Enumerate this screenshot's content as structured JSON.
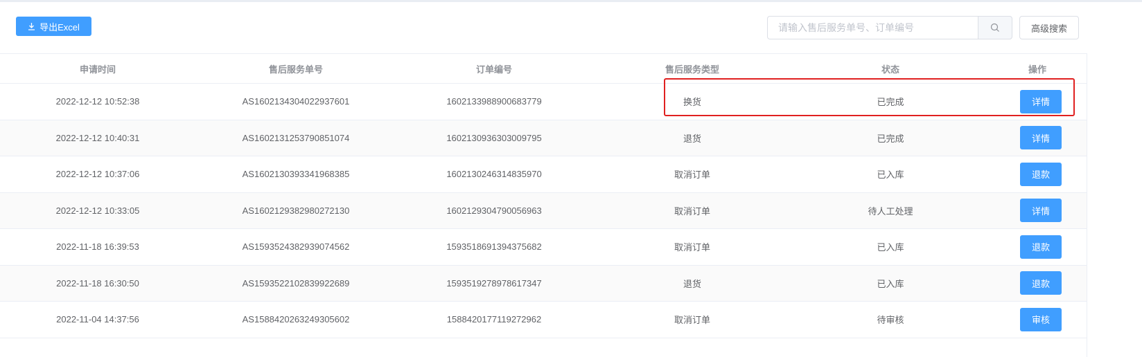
{
  "toolbar": {
    "export_label": "导出Excel",
    "search_placeholder": "请输入售后服务单号、订单编号",
    "search_value": "",
    "advanced_search_label": "高级搜索"
  },
  "table": {
    "headers": [
      "申请时间",
      "售后服务单号",
      "订单编号",
      "售后服务类型",
      "状态",
      "操作"
    ],
    "rows": [
      {
        "time": "2022-12-12 10:52:38",
        "service_no": "AS1602134304022937601",
        "order_no": "1602133988900683779",
        "type": "换货",
        "status": "已完成",
        "action": "详情"
      },
      {
        "time": "2022-12-12 10:40:31",
        "service_no": "AS1602131253790851074",
        "order_no": "1602130936303009795",
        "type": "退货",
        "status": "已完成",
        "action": "详情"
      },
      {
        "time": "2022-12-12 10:37:06",
        "service_no": "AS1602130393341968385",
        "order_no": "1602130246314835970",
        "type": "取消订单",
        "status": "已入库",
        "action": "退款"
      },
      {
        "time": "2022-12-12 10:33:05",
        "service_no": "AS1602129382980272130",
        "order_no": "1602129304790056963",
        "type": "取消订单",
        "status": "待人工处理",
        "action": "详情"
      },
      {
        "time": "2022-11-18 16:39:53",
        "service_no": "AS1593524382939074562",
        "order_no": "1593518691394375682",
        "type": "取消订单",
        "status": "已入库",
        "action": "退款"
      },
      {
        "time": "2022-11-18 16:30:50",
        "service_no": "AS1593522102839922689",
        "order_no": "1593519278978617347",
        "type": "退货",
        "status": "已入库",
        "action": "退款"
      },
      {
        "time": "2022-11-04 14:37:56",
        "service_no": "AS1588420263249305602",
        "order_no": "1588420177119272962",
        "type": "取消订单",
        "status": "待审核",
        "action": "审核"
      }
    ]
  },
  "colors": {
    "primary": "#409eff",
    "highlight": "#e02020",
    "border": "#ebeef5"
  }
}
